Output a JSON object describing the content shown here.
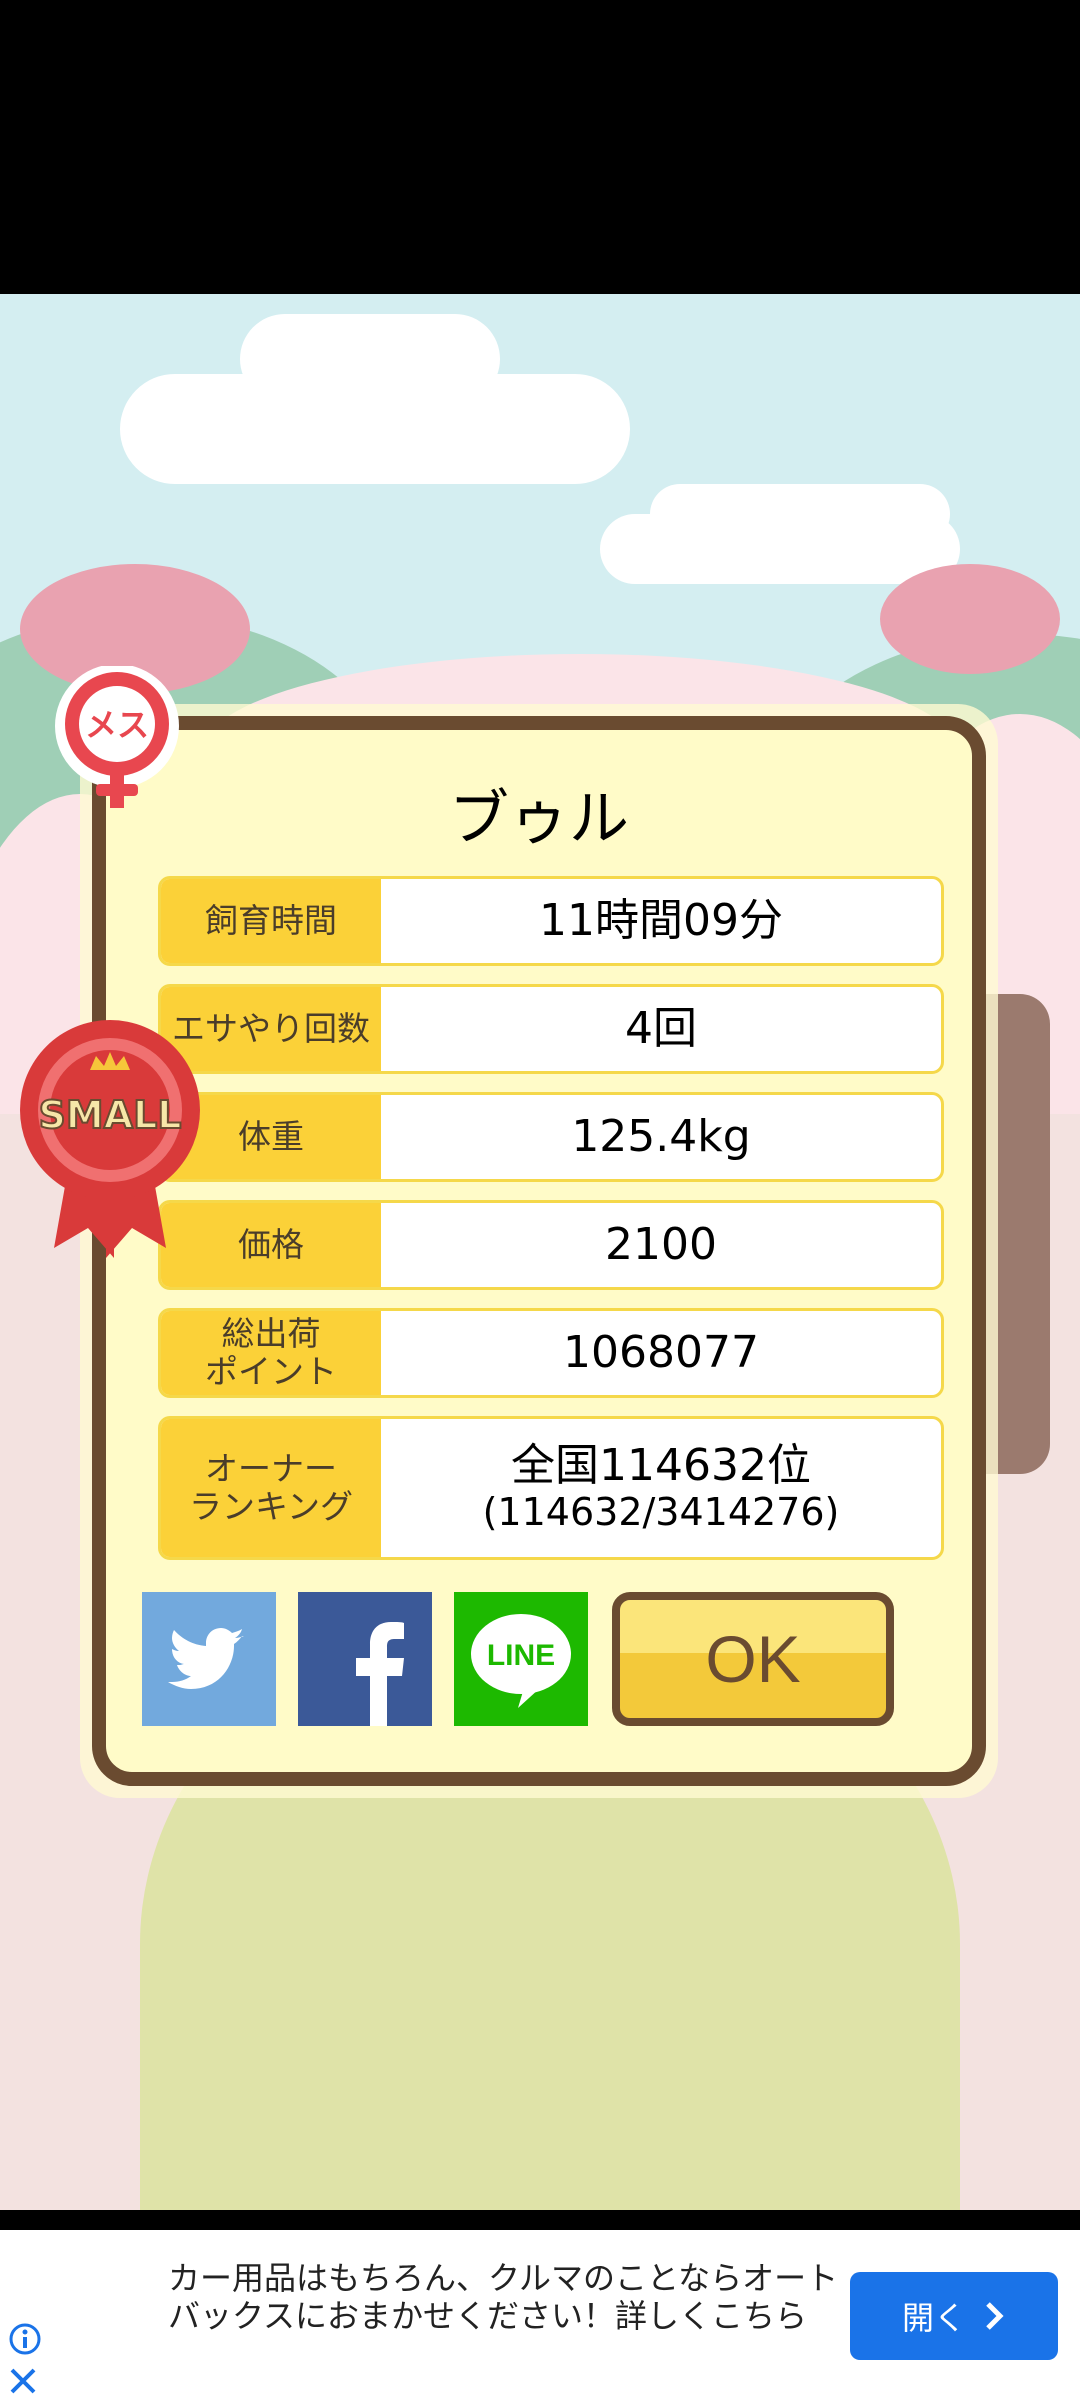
{
  "pet": {
    "name": "ブゥル",
    "gender_badge": "メス",
    "size_ribbon": "SMALL"
  },
  "stats": [
    {
      "label": "飼育時間",
      "value": "11時間09分"
    },
    {
      "label": "エサやり回数",
      "value": "4回"
    },
    {
      "label": "体重",
      "value": "125.4kg"
    },
    {
      "label": "価格",
      "value": "2100"
    },
    {
      "label": "総出荷\nポイント",
      "value": "1068077"
    },
    {
      "label": "オーナー\nランキング",
      "value": "全国114632位",
      "sub": "(114632/3414276)"
    }
  ],
  "buttons": {
    "ok": "OK",
    "line": "LINE"
  },
  "ad": {
    "text": "カー用品はもちろん、クルマのことならオートバックスにおまかせください！詳しくこちら",
    "open": "開く"
  },
  "colors": {
    "dialog_border": "#6a4b30",
    "dialog_bg": "#fffbc8",
    "label_bg": "#fbd138",
    "ad_button": "#1a73e8"
  }
}
